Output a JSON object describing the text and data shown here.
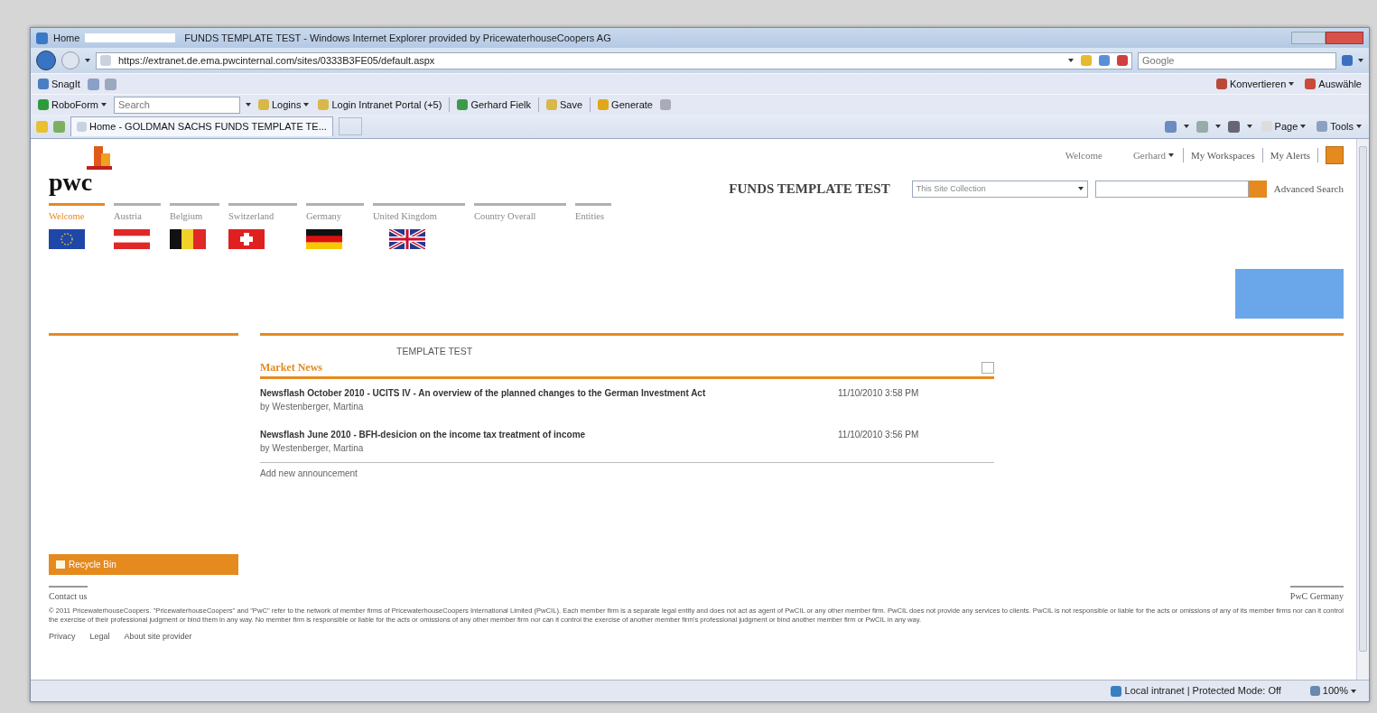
{
  "window": {
    "title_prefix": "Home",
    "title": "FUNDS TEMPLATE TEST - Windows Internet Explorer provided by PricewaterhouseCoopers AG"
  },
  "address_bar": {
    "url": "https://extranet.de.ema.pwcinternal.com/sites/0333B3FE05/default.aspx",
    "search_placeholder": "Google"
  },
  "command_bar": {
    "left": [
      {
        "label": "SnagIt"
      }
    ],
    "right": [
      {
        "label": "Konvertieren"
      },
      {
        "label": "Auswähle"
      }
    ]
  },
  "roboform_toolbar": {
    "menu": "RoboForm",
    "search_placeholder": "Search",
    "items": [
      {
        "label": "Logins",
        "dropdown": true
      },
      {
        "label": "Login Intranet Portal (+5)",
        "dropdown": false
      },
      {
        "label": "Gerhard Fielk",
        "dropdown": false
      },
      {
        "label": "Save",
        "dropdown": false
      },
      {
        "label": "Generate",
        "dropdown": false
      }
    ]
  },
  "browser_tabs": [
    {
      "label": "Home - GOLDMAN SACHS FUNDS TEMPLATE TE...",
      "selected": true
    }
  ],
  "browser_commands": [
    {
      "label": "Page"
    },
    {
      "label": "Tools"
    }
  ],
  "page": {
    "logo_text": "pwc",
    "top_links": {
      "welcome": "Welcome",
      "user": "Gerhard",
      "links": [
        "My Workspaces",
        "My Alerts"
      ]
    },
    "site_title": "FUNDS TEMPLATE TEST",
    "search_scope": "This Site Collection",
    "advanced_search": "Advanced Search",
    "nav_tabs": [
      {
        "label": "Welcome",
        "selected": true,
        "kind": "eu"
      },
      {
        "label": "Austria",
        "selected": false,
        "kind": "austria"
      },
      {
        "label": "Belgium",
        "selected": false,
        "kind": "belgium"
      },
      {
        "label": "Switzerland",
        "selected": false,
        "kind": "switzerland"
      },
      {
        "label": "Germany",
        "selected": false,
        "kind": "germany"
      },
      {
        "label": "United Kingdom",
        "selected": false,
        "kind": "uk"
      },
      {
        "label": "Country Overall",
        "selected": false,
        "kind": "none"
      },
      {
        "label": "Entities",
        "selected": false,
        "kind": "none"
      }
    ],
    "recycle_bin": "Recycle Bin",
    "section_title": "TEMPLATE TEST",
    "webpart": {
      "title": "Market News",
      "items": [
        {
          "title": "Newsflash October 2010 - UCITS IV - An overview of the planned changes to the German Investment Act",
          "author": "by Westenberger, Martina",
          "date": "11/10/2010 3:58 PM"
        },
        {
          "title": "Newsflash June 2010 - BFH-desicion on the income tax treatment of income",
          "author": "by Westenberger, Martina",
          "date": "11/10/2010 3:56 PM"
        }
      ],
      "add_link": "Add new announcement"
    },
    "footer": {
      "contact": "Contact us",
      "brand": "PwC Germany",
      "copyright": "© 2011 PricewaterhouseCoopers. \"PricewaterhouseCoopers\" and \"PwC\" refer to the network of member firms of PricewaterhouseCoopers International Limited (PwCIL). Each member firm is a separate legal entity and does not act as agent of PwCIL or any other member firm. PwCIL does not provide any services to clients. PwCIL is not responsible or liable for the acts or omissions of any of its member firms nor can it control the exercise of their professional judgment or bind them in any way. No member firm is responsible or liable for the acts or omissions of any other member firm nor can it control the exercise of another member firm's professional judgment or bind another member firm or PwCIL in any way.",
      "links": [
        "Privacy",
        "Legal",
        "About site provider"
      ]
    }
  },
  "status_bar": {
    "zone": "Local intranet | Protected Mode: Off",
    "zoom": "100%"
  }
}
